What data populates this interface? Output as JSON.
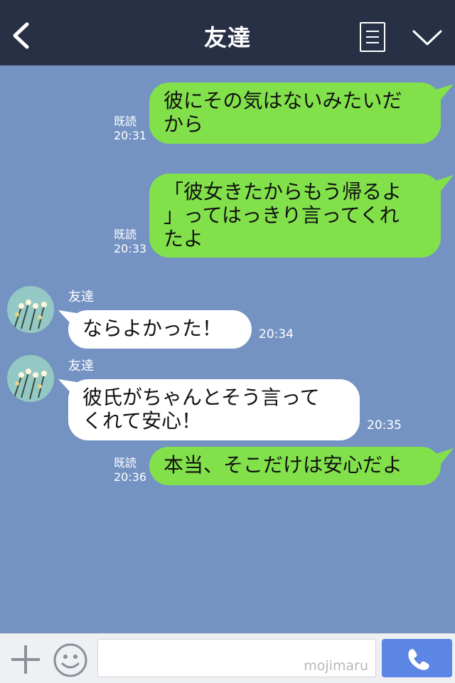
{
  "header": {
    "title": "友達"
  },
  "messages": [
    {
      "from": "me",
      "lines": [
        "彼にその気はないみたいだ",
        "から"
      ],
      "read": "既読",
      "time": "20:31"
    },
    {
      "from": "me",
      "lines": [
        "「彼女きたからもう帰るよ",
        "」ってはっきり言ってくれ",
        "たよ"
      ],
      "read": "既読",
      "time": "20:33"
    },
    {
      "from": "friend",
      "sender": "友達",
      "lines": [
        "ならよかった！"
      ],
      "time": "20:34"
    },
    {
      "from": "friend",
      "sender": "友達",
      "lines": [
        "彼氏がちゃんとそう言って",
        "くれて安心！"
      ],
      "time": "20:35"
    },
    {
      "from": "me",
      "lines": [
        "本当、そこだけは安心だよ"
      ],
      "read": "既読",
      "time": "20:36"
    }
  ],
  "footer": {
    "watermark": "mojimaru"
  },
  "colors": {
    "background": "#7493c2",
    "header": "#283046",
    "my_bubble": "#82e14b",
    "friend_bubble": "#ffffff",
    "call_button": "#5b86e3"
  },
  "icons": [
    "back-icon",
    "menu-icon",
    "chevron-down-icon",
    "plus-icon",
    "emoji-icon",
    "phone-icon"
  ]
}
